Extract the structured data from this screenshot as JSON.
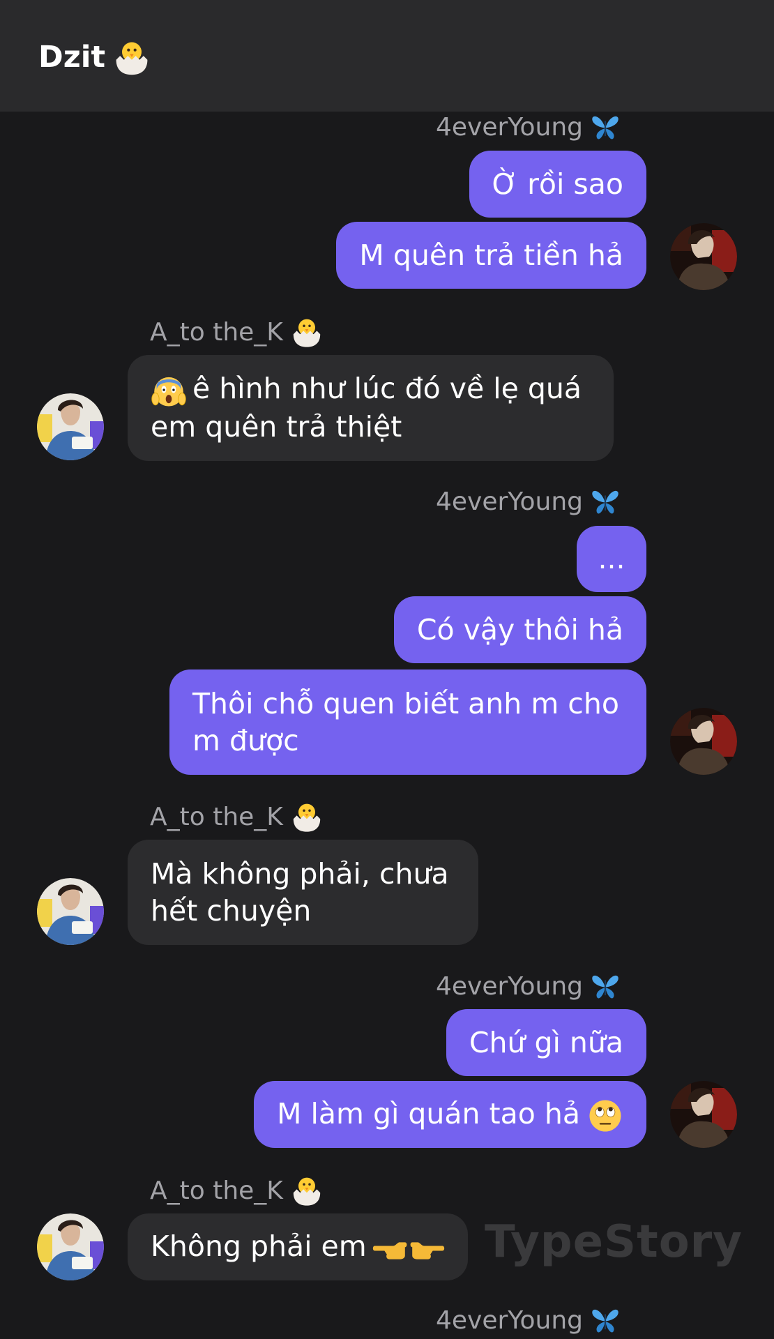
{
  "header": {
    "title": "Dzit",
    "title_emoji": "hatching-chick-emoji"
  },
  "senders": {
    "me": "4everYoung",
    "me_emoji": "butterfly-emoji",
    "other": "A_to the_K",
    "other_emoji": "hatching-chick-emoji"
  },
  "messages": [
    {
      "from": "me",
      "text": "Ờ rồi sao"
    },
    {
      "from": "me",
      "text": "M quên trả tiền hả"
    },
    {
      "from": "other",
      "text": "ê hình như lúc đó về lẹ quá em quên trả thiệt",
      "emoji": "screaming-face-emoji"
    },
    {
      "from": "me",
      "text": "..."
    },
    {
      "from": "me",
      "text": "Có vậy thôi hả"
    },
    {
      "from": "me",
      "text": "Thôi chỗ quen biết anh m cho m được"
    },
    {
      "from": "other",
      "text": "Mà không phải, chưa hết chuyện"
    },
    {
      "from": "me",
      "text": "Chứ gì nữa"
    },
    {
      "from": "me",
      "text": "M làm gì quán tao hả",
      "emoji": "eye-roll-emoji"
    },
    {
      "from": "other",
      "text": "Không phải em",
      "emoji": "pointing-fingers-emoji"
    }
  ],
  "watermark": "TypeStory",
  "colors": {
    "outgoing": "#7562ef",
    "incoming": "#2c2c2e",
    "background": "#19191b",
    "header": "#2a2a2c"
  }
}
